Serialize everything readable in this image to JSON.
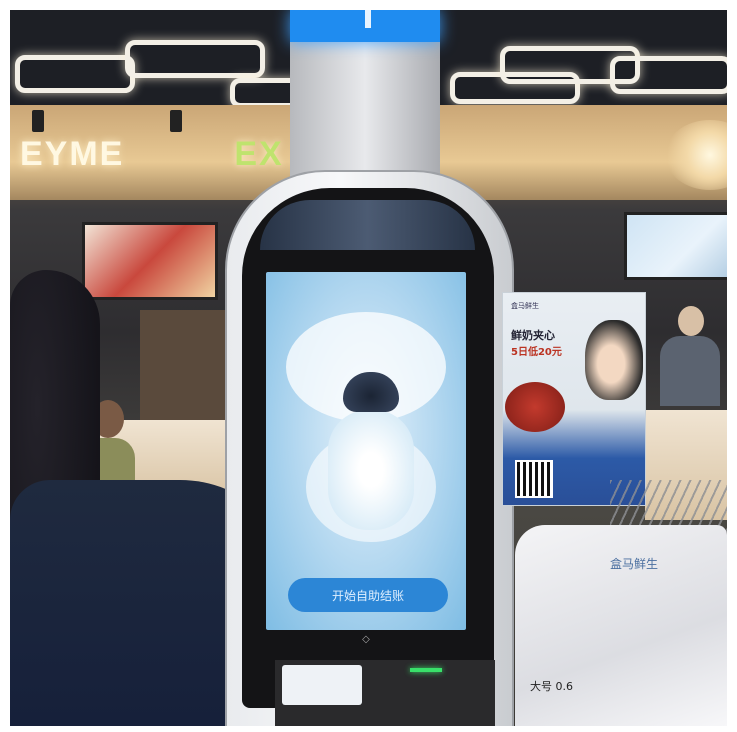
{
  "scene": {
    "type": "photo",
    "subject": "self-checkout kiosk in a store"
  },
  "storefront": {
    "sign_text": "EYME",
    "sign_suffix": "EX"
  },
  "kiosk": {
    "screen_button_label": "开始自助结账",
    "logo_glyph": "◇"
  },
  "poster": {
    "brand": "盒马鲜生",
    "headline_1": "鲜奶夹心",
    "headline_2": "5日低20元"
  },
  "bag": {
    "brand_text": "盒马鲜生",
    "size_label": "大号 0.6"
  },
  "colors": {
    "kiosk_accent": "#1f8cf0",
    "screen_button": "#2c86d6",
    "status_led": "#39e06a"
  }
}
